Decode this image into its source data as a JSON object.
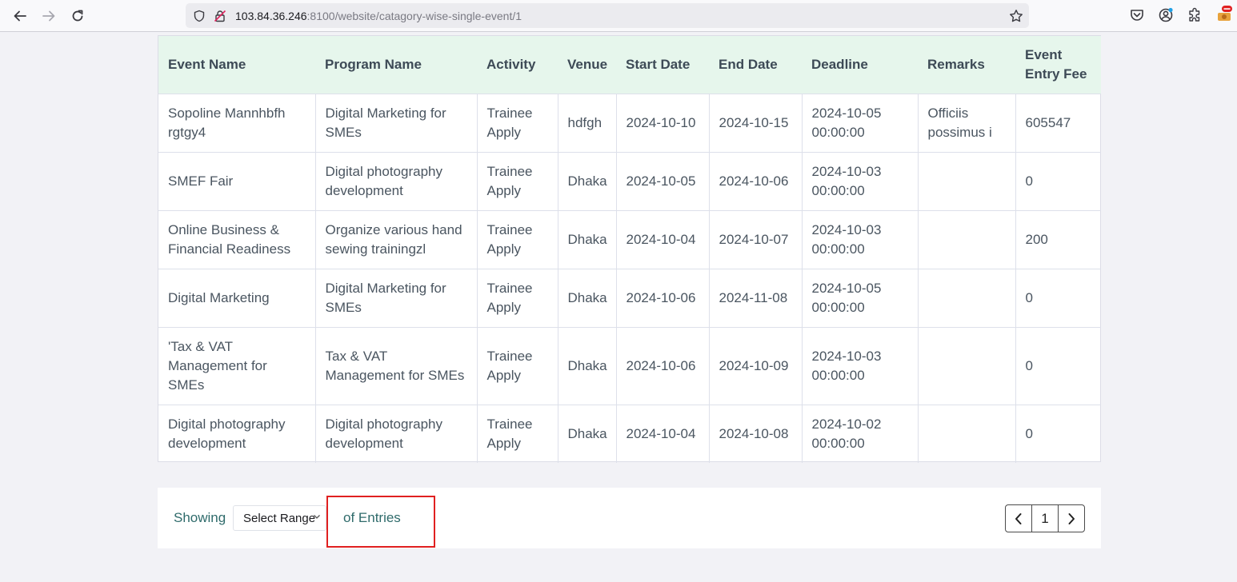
{
  "browser": {
    "url_host": "103.84.36.246",
    "url_path": ":8100/website/catagory-wise-single-event/1",
    "back_icon": "back-arrow-icon",
    "forward_icon": "forward-arrow-icon",
    "reload_icon": "reload-icon"
  },
  "table": {
    "headers": [
      "Event Name",
      "Program Name",
      "Activity",
      "Venue",
      "Start Date",
      "End Date",
      "Deadline",
      "Remarks",
      "Event Entry Fee"
    ],
    "rows": [
      {
        "event_name": "Sopoline Mannhbfh rgtgy4",
        "program_name": "Digital Marketing for SMEs",
        "activity": "Trainee Apply",
        "venue": "hdfgh",
        "start_date": "2024-10-10",
        "end_date": "2024-10-15",
        "deadline": "2024-10-05 00:00:00",
        "remarks": "Officiis possimus i",
        "fee": "605547"
      },
      {
        "event_name": "SMEF Fair",
        "program_name": "Digital photography development",
        "activity": "Trainee Apply",
        "venue": "Dhaka",
        "start_date": "2024-10-05",
        "end_date": "2024-10-06",
        "deadline": "2024-10-03 00:00:00",
        "remarks": "",
        "fee": "0"
      },
      {
        "event_name": "Online Business & Financial Readiness",
        "program_name": "Organize various hand sewing trainingzl",
        "activity": "Trainee Apply",
        "venue": "Dhaka",
        "start_date": "2024-10-04",
        "end_date": "2024-10-07",
        "deadline": "2024-10-03 00:00:00",
        "remarks": "",
        "fee": "200"
      },
      {
        "event_name": "Digital Marketing",
        "program_name": "Digital Marketing for SMEs",
        "activity": "Trainee Apply",
        "venue": "Dhaka",
        "start_date": "2024-10-06",
        "end_date": "2024-11-08",
        "deadline": "2024-10-05 00:00:00",
        "remarks": "",
        "fee": "0"
      },
      {
        "event_name": "'Tax & VAT Management for SMEs",
        "program_name": "Tax & VAT Management for SMEs",
        "activity": "Trainee Apply",
        "venue": "Dhaka",
        "start_date": "2024-10-06",
        "end_date": "2024-10-09",
        "deadline": "2024-10-03 00:00:00",
        "remarks": "",
        "fee": "0"
      },
      {
        "event_name": "Digital photography development",
        "program_name": "Digital photography development",
        "activity": "Trainee Apply",
        "venue": "Dhaka",
        "start_date": "2024-10-04",
        "end_date": "2024-10-08",
        "deadline": "2024-10-02 00:00:00",
        "remarks": "",
        "fee": "0"
      }
    ]
  },
  "footer": {
    "showing_label": "Showing",
    "range_select_value": "Select Range",
    "entries_label": "of Entries",
    "current_page": "1"
  },
  "colors": {
    "header_bg": "#e6f6ec",
    "accent_text": "#2f6b6b",
    "highlight": "#e02020"
  }
}
